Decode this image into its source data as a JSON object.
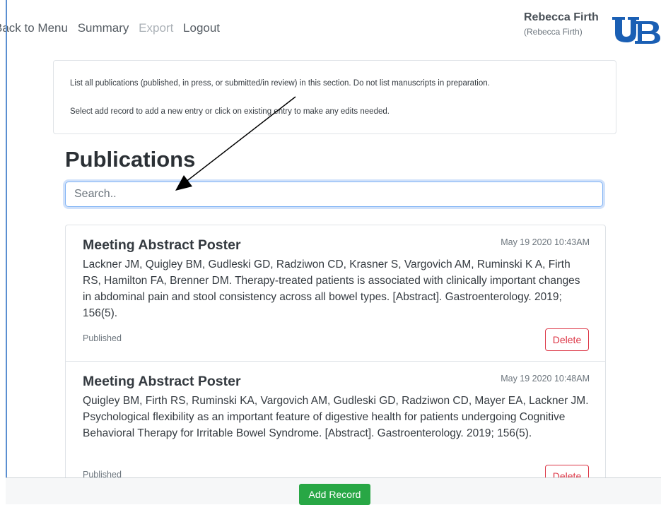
{
  "nav": {
    "items": [
      "Back to Menu",
      "Summary",
      "Export",
      "Logout"
    ]
  },
  "user": {
    "name": "Rebecca Firth",
    "sub": "(Rebecca Firth)"
  },
  "info": {
    "line1": "List all publications (published, in press, or submitted/in review) in this section. Do not list manuscripts in preparation.",
    "line2": "Select add record to add a new entry or click on existing entry to make any edits needed."
  },
  "page": {
    "title": "Publications"
  },
  "search": {
    "placeholder": "Search.."
  },
  "records": [
    {
      "type": "Meeting Abstract Poster",
      "date": "May 19 2020 10:43AM",
      "citation": "Lackner JM, Quigley BM, Gudleski GD, Radziwon CD, Krasner S, Vargovich AM, Ruminski K A, Firth RS, Hamilton FA, Brenner DM. Therapy-treated patients is associated with clinically important changes in abdominal pain and stool consistency across all bowel types. [Abstract]. Gastroenterology. 2019; 156(5).",
      "status": "Published",
      "delete_label": "Delete"
    },
    {
      "type": "Meeting Abstract Poster",
      "date": "May 19 2020 10:48AM",
      "citation": "Quigley BM, Firth RS, Ruminski KA, Vargovich AM, Gudleski GD, Radziwon CD, Mayer EA, Lackner JM. Psychological flexibility as an important feature of digestive health for patients undergoing Cognitive Behavioral Therapy for Irritable Bowel Syndrome. [Abstract]. Gastroenterology. 2019; 156(5).",
      "status": "Published",
      "delete_label": "Delete"
    }
  ],
  "footer": {
    "add_label": "Add Record"
  },
  "colors": {
    "primary_text": "#343a40",
    "muted": "#6c757d",
    "danger": "#dc3545",
    "success": "#28a745",
    "logo_blue": "#1a5fb4"
  }
}
